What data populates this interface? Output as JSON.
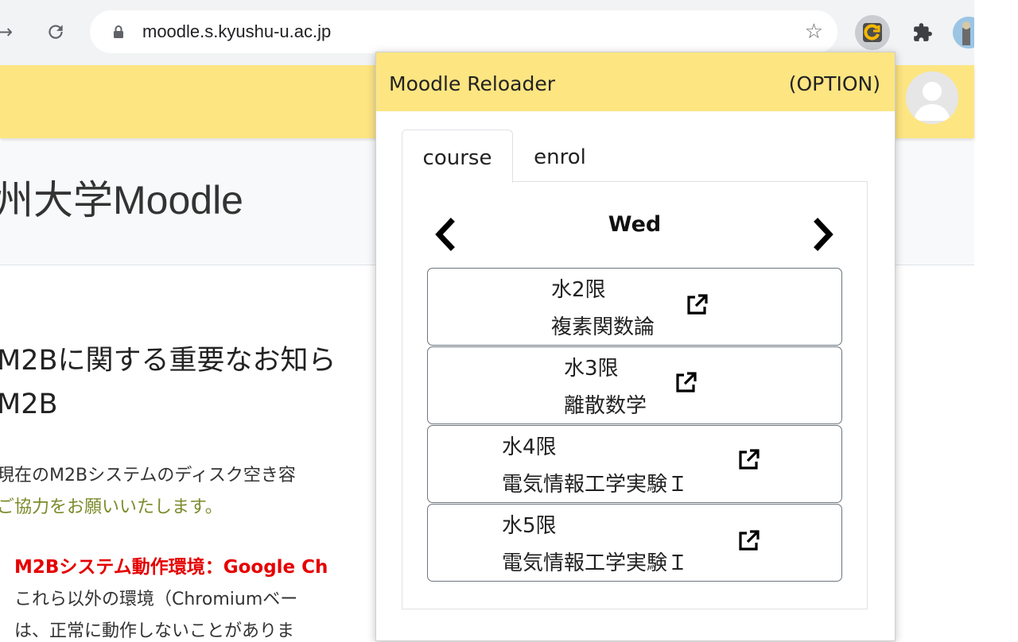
{
  "browser": {
    "url": "moodle.s.kyushu-u.ac.jp",
    "back_glyph": "→",
    "reload_glyph": "C"
  },
  "moodle": {
    "site_title_jp": "州大学",
    "site_title_en": "Moodle",
    "news_title": "M2Bに関する重要なお知ら",
    "news_subtitle": "M2B",
    "para_line1": "現在のM2Bシステムのディスク空き容",
    "para_line2": "ご協力をお願いいたします。",
    "env_heading": "M2Bシステム動作環境：Google Ch",
    "env_line1": "これら以外の環境（Chromiumベー",
    "env_line2": "は、正常に動作しないことがありま"
  },
  "popup": {
    "title": "Moodle Reloader",
    "option_label": "(OPTION)",
    "tabs": [
      {
        "label": "course",
        "active": true
      },
      {
        "label": "enrol",
        "active": false
      }
    ],
    "day": "Wed",
    "courses": [
      {
        "period": "水2限",
        "name": "複素関数論"
      },
      {
        "period": "水3限",
        "name": "離散数学"
      },
      {
        "period": "水4限",
        "name": "電気情報工学実験Ｉ"
      },
      {
        "period": "水5限",
        "name": "電気情報工学実験Ｉ"
      }
    ]
  },
  "colors": {
    "accent_yellow": "#fde582",
    "warning_red": "#e60000",
    "note_olive": "#7b8b2b"
  }
}
